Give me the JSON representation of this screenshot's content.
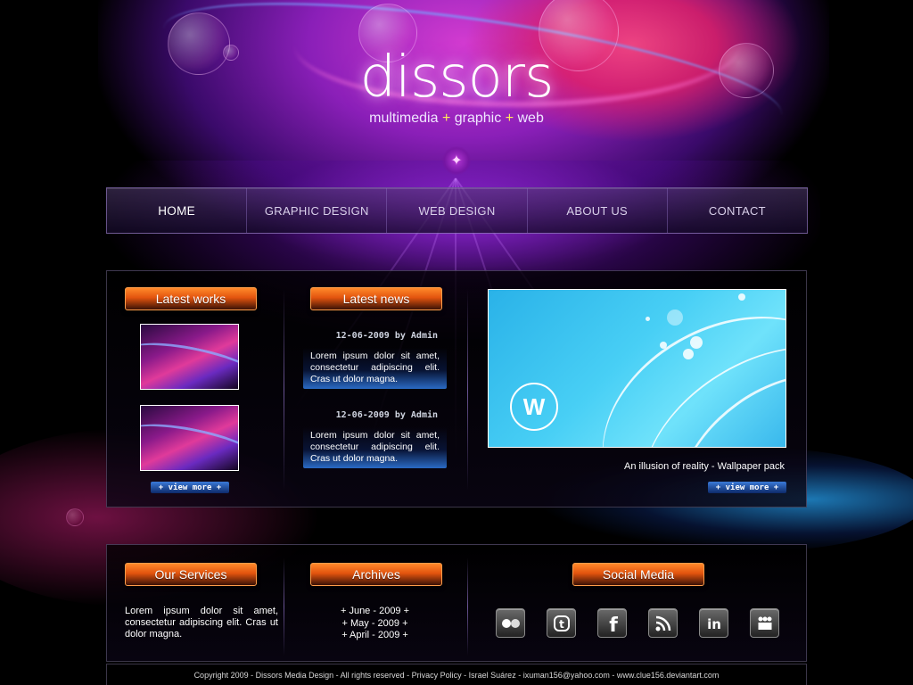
{
  "brand": {
    "logo_text": "dissors",
    "tagline": {
      "part1": "multimedia",
      "plus1": "+",
      "part2": "graphic",
      "plus2": "+",
      "part3": "web"
    }
  },
  "nav": {
    "items": [
      {
        "label": "HOME",
        "active": true
      },
      {
        "label": "GRAPHIC DESIGN",
        "active": false
      },
      {
        "label": "WEB DESIGN",
        "active": false
      },
      {
        "label": "ABOUT US",
        "active": false
      },
      {
        "label": "CONTACT",
        "active": false
      }
    ]
  },
  "latest_works": {
    "title": "Latest works",
    "view_more": "+ view more +"
  },
  "latest_news": {
    "title": "Latest news",
    "items": [
      {
        "date": "12-06-2009 by Admin",
        "text": "Lorem ipsum dolor sit amet, consectetur adipiscing elit. Cras ut dolor magna."
      },
      {
        "date": "12-06-2009 by Admin",
        "text": "Lorem ipsum dolor sit amet, consectetur adipiscing elit. Cras ut dolor magna."
      }
    ]
  },
  "feature": {
    "caption": "An illusion of reality - Wallpaper pack",
    "view_more": "+ view more +"
  },
  "services": {
    "title": "Our Services",
    "text": "Lorem ipsum dolor sit amet, consectetur adipiscing elit. Cras ut dolor magna."
  },
  "archives": {
    "title": "Archives",
    "items": [
      "+ June - 2009 +",
      "+ May - 2009 +",
      "+ April - 2009 +"
    ]
  },
  "social": {
    "title": "Social Media",
    "icons": [
      "flickr-icon",
      "twitter-icon",
      "facebook-icon",
      "rss-icon",
      "linkedin-icon",
      "myspace-icon"
    ]
  },
  "footer": {
    "text": "Copyright 2009 - Dissors Media Design - All rights reserved - Privacy Policy - Israel Suárez - ixuman156@yahoo.com - www.clue156.deviantart.com"
  },
  "colors": {
    "accent_orange": "#e2540e",
    "accent_yellow": "#ffe95a",
    "button_blue": "#2a6ac4"
  }
}
